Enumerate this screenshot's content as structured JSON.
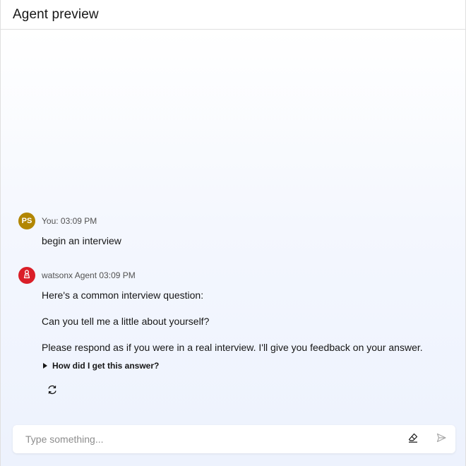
{
  "header": {
    "title": "Agent preview"
  },
  "messages": [
    {
      "role": "user",
      "avatar_initials": "PS",
      "meta": "You: 03:09 PM",
      "lines": [
        "begin an interview"
      ]
    },
    {
      "role": "agent",
      "avatar_icon": "watsonx-agent-icon",
      "meta": "watsonx Agent 03:09 PM",
      "lines": [
        "Here's a common interview question:",
        "Can you tell me a little about yourself?",
        "Please respond as if you were in a real interview. I'll give you feedback on your answer."
      ],
      "details_label": "How did I get this answer?"
    }
  ],
  "composer": {
    "placeholder": "Type something...",
    "clear_icon": "eraser-icon",
    "send_icon": "send-icon"
  },
  "colors": {
    "user_avatar": "#b28600",
    "agent_avatar": "#da1e28",
    "placeholder": "#8d8d8d"
  }
}
